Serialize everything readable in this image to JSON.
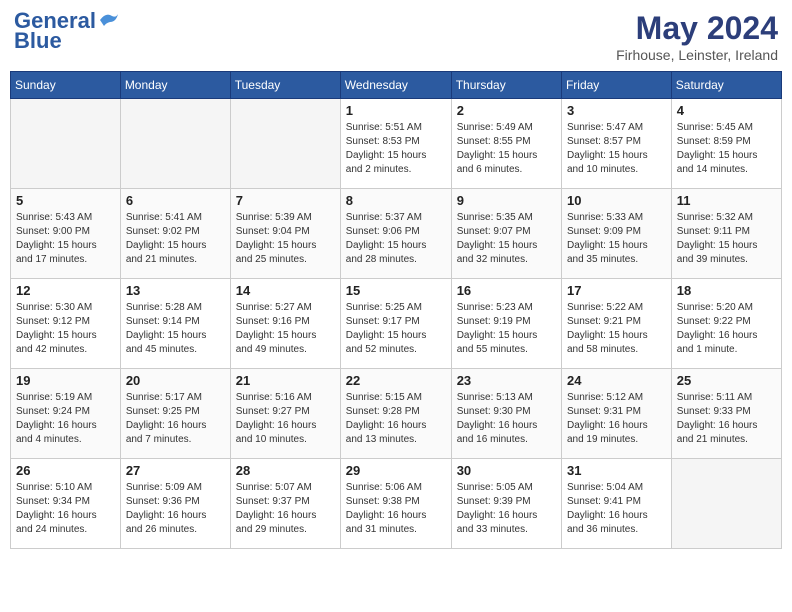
{
  "header": {
    "logo_line1": "General",
    "logo_line2": "Blue",
    "month_year": "May 2024",
    "location": "Firhouse, Leinster, Ireland"
  },
  "weekdays": [
    "Sunday",
    "Monday",
    "Tuesday",
    "Wednesday",
    "Thursday",
    "Friday",
    "Saturday"
  ],
  "weeks": [
    [
      {
        "num": "",
        "info": ""
      },
      {
        "num": "",
        "info": ""
      },
      {
        "num": "",
        "info": ""
      },
      {
        "num": "1",
        "info": "Sunrise: 5:51 AM\nSunset: 8:53 PM\nDaylight: 15 hours\nand 2 minutes."
      },
      {
        "num": "2",
        "info": "Sunrise: 5:49 AM\nSunset: 8:55 PM\nDaylight: 15 hours\nand 6 minutes."
      },
      {
        "num": "3",
        "info": "Sunrise: 5:47 AM\nSunset: 8:57 PM\nDaylight: 15 hours\nand 10 minutes."
      },
      {
        "num": "4",
        "info": "Sunrise: 5:45 AM\nSunset: 8:59 PM\nDaylight: 15 hours\nand 14 minutes."
      }
    ],
    [
      {
        "num": "5",
        "info": "Sunrise: 5:43 AM\nSunset: 9:00 PM\nDaylight: 15 hours\nand 17 minutes."
      },
      {
        "num": "6",
        "info": "Sunrise: 5:41 AM\nSunset: 9:02 PM\nDaylight: 15 hours\nand 21 minutes."
      },
      {
        "num": "7",
        "info": "Sunrise: 5:39 AM\nSunset: 9:04 PM\nDaylight: 15 hours\nand 25 minutes."
      },
      {
        "num": "8",
        "info": "Sunrise: 5:37 AM\nSunset: 9:06 PM\nDaylight: 15 hours\nand 28 minutes."
      },
      {
        "num": "9",
        "info": "Sunrise: 5:35 AM\nSunset: 9:07 PM\nDaylight: 15 hours\nand 32 minutes."
      },
      {
        "num": "10",
        "info": "Sunrise: 5:33 AM\nSunset: 9:09 PM\nDaylight: 15 hours\nand 35 minutes."
      },
      {
        "num": "11",
        "info": "Sunrise: 5:32 AM\nSunset: 9:11 PM\nDaylight: 15 hours\nand 39 minutes."
      }
    ],
    [
      {
        "num": "12",
        "info": "Sunrise: 5:30 AM\nSunset: 9:12 PM\nDaylight: 15 hours\nand 42 minutes."
      },
      {
        "num": "13",
        "info": "Sunrise: 5:28 AM\nSunset: 9:14 PM\nDaylight: 15 hours\nand 45 minutes."
      },
      {
        "num": "14",
        "info": "Sunrise: 5:27 AM\nSunset: 9:16 PM\nDaylight: 15 hours\nand 49 minutes."
      },
      {
        "num": "15",
        "info": "Sunrise: 5:25 AM\nSunset: 9:17 PM\nDaylight: 15 hours\nand 52 minutes."
      },
      {
        "num": "16",
        "info": "Sunrise: 5:23 AM\nSunset: 9:19 PM\nDaylight: 15 hours\nand 55 minutes."
      },
      {
        "num": "17",
        "info": "Sunrise: 5:22 AM\nSunset: 9:21 PM\nDaylight: 15 hours\nand 58 minutes."
      },
      {
        "num": "18",
        "info": "Sunrise: 5:20 AM\nSunset: 9:22 PM\nDaylight: 16 hours\nand 1 minute."
      }
    ],
    [
      {
        "num": "19",
        "info": "Sunrise: 5:19 AM\nSunset: 9:24 PM\nDaylight: 16 hours\nand 4 minutes."
      },
      {
        "num": "20",
        "info": "Sunrise: 5:17 AM\nSunset: 9:25 PM\nDaylight: 16 hours\nand 7 minutes."
      },
      {
        "num": "21",
        "info": "Sunrise: 5:16 AM\nSunset: 9:27 PM\nDaylight: 16 hours\nand 10 minutes."
      },
      {
        "num": "22",
        "info": "Sunrise: 5:15 AM\nSunset: 9:28 PM\nDaylight: 16 hours\nand 13 minutes."
      },
      {
        "num": "23",
        "info": "Sunrise: 5:13 AM\nSunset: 9:30 PM\nDaylight: 16 hours\nand 16 minutes."
      },
      {
        "num": "24",
        "info": "Sunrise: 5:12 AM\nSunset: 9:31 PM\nDaylight: 16 hours\nand 19 minutes."
      },
      {
        "num": "25",
        "info": "Sunrise: 5:11 AM\nSunset: 9:33 PM\nDaylight: 16 hours\nand 21 minutes."
      }
    ],
    [
      {
        "num": "26",
        "info": "Sunrise: 5:10 AM\nSunset: 9:34 PM\nDaylight: 16 hours\nand 24 minutes."
      },
      {
        "num": "27",
        "info": "Sunrise: 5:09 AM\nSunset: 9:36 PM\nDaylight: 16 hours\nand 26 minutes."
      },
      {
        "num": "28",
        "info": "Sunrise: 5:07 AM\nSunset: 9:37 PM\nDaylight: 16 hours\nand 29 minutes."
      },
      {
        "num": "29",
        "info": "Sunrise: 5:06 AM\nSunset: 9:38 PM\nDaylight: 16 hours\nand 31 minutes."
      },
      {
        "num": "30",
        "info": "Sunrise: 5:05 AM\nSunset: 9:39 PM\nDaylight: 16 hours\nand 33 minutes."
      },
      {
        "num": "31",
        "info": "Sunrise: 5:04 AM\nSunset: 9:41 PM\nDaylight: 16 hours\nand 36 minutes."
      },
      {
        "num": "",
        "info": ""
      }
    ]
  ]
}
